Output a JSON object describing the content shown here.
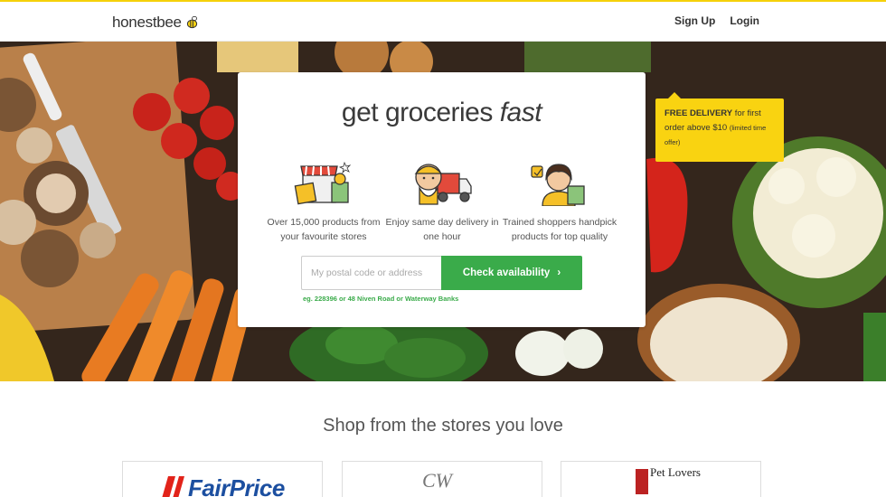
{
  "header": {
    "logo": "honestbee",
    "nav": {
      "signup": "Sign Up",
      "login": "Login"
    }
  },
  "hero": {
    "headline_main": "get groceries",
    "headline_emph": "fast",
    "features": [
      {
        "icon": "store-icon",
        "text": "Over 15,000 products from your favourite stores"
      },
      {
        "icon": "delivery-truck-icon",
        "text": "Enjoy same day delivery in one hour"
      },
      {
        "icon": "shopper-icon",
        "text": "Trained shoppers handpick products for top quality"
      }
    ],
    "postal": {
      "placeholder": "My postal code or address",
      "value": ""
    },
    "check_label": "Check availability",
    "hint": "eg. 228396 or 48 Niven Road or Waterway Banks"
  },
  "promo": {
    "bold": "FREE DELIVERY",
    "text": "for first order above $10",
    "small": "(limited time offer)"
  },
  "stores": {
    "title": "Shop from the stores you love",
    "items": [
      {
        "name": "FairPrice"
      },
      {
        "name": "CW"
      },
      {
        "name": "Pet Lovers"
      }
    ]
  },
  "colors": {
    "accent_green": "#3aab4a",
    "brand_yellow": "#f9d311"
  }
}
